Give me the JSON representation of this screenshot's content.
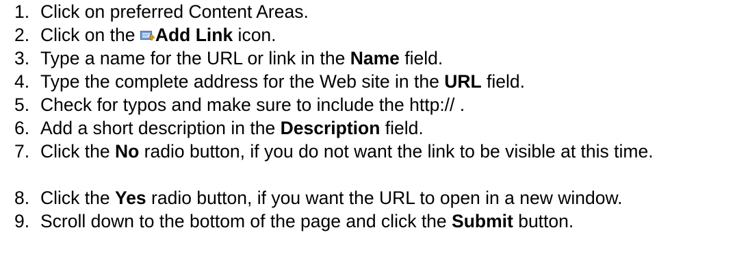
{
  "steps": [
    {
      "num": "1.",
      "text": "Click on preferred Content Areas."
    },
    {
      "num": "2.",
      "pre": "Click on the ",
      "icon": "add-link-icon",
      "bold": "Add Link",
      "post": " icon."
    },
    {
      "num": "3.",
      "pre": "Type a name for the URL or link in the ",
      "bold": "Name",
      "post": " field."
    },
    {
      "num": "4.",
      "pre": "Type the complete address for the Web site in the ",
      "bold": "URL",
      "post": " field."
    },
    {
      "num": "5.",
      "text": "Check for typos and make sure to include the http:// ."
    },
    {
      "num": "6.",
      "pre": "Add a short description in the ",
      "bold": "Description",
      "post": " field."
    },
    {
      "num": "7.",
      "pre": "Click the ",
      "bold": "No",
      "post": " radio button, if you do not want the link to be visible at this time."
    },
    {
      "num": "8.",
      "pre": "Click the ",
      "bold": "Yes",
      "post": " radio button, if you want the URL to open in a new window."
    },
    {
      "num": "9.",
      "pre": "Scroll down to the bottom of the page and click the ",
      "bold": "Submit",
      "post": " button."
    }
  ]
}
